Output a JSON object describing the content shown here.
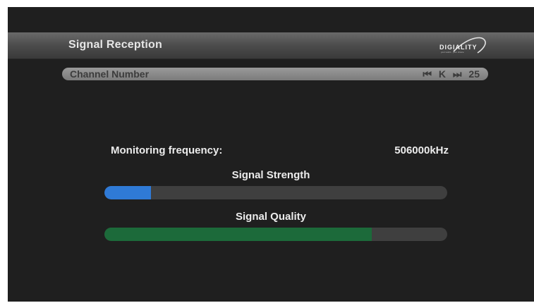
{
  "header": {
    "title": "Signal Reception",
    "logo_text": "DIGIALITY",
    "logo_tagline": "your world... your choice"
  },
  "channel": {
    "label": "Channel Number",
    "prev_icon": "skip-back-icon",
    "band": "K",
    "next_icon": "skip-forward-icon",
    "number": "25"
  },
  "frequency": {
    "label": "Monitoring frequency:",
    "value": "506000kHz"
  },
  "signal_strength": {
    "label": "Signal Strength",
    "level": 0.135,
    "color": "#2f7ad6"
  },
  "signal_quality": {
    "label": "Signal Quality",
    "level": 0.78,
    "color": "#1c6a3a"
  }
}
